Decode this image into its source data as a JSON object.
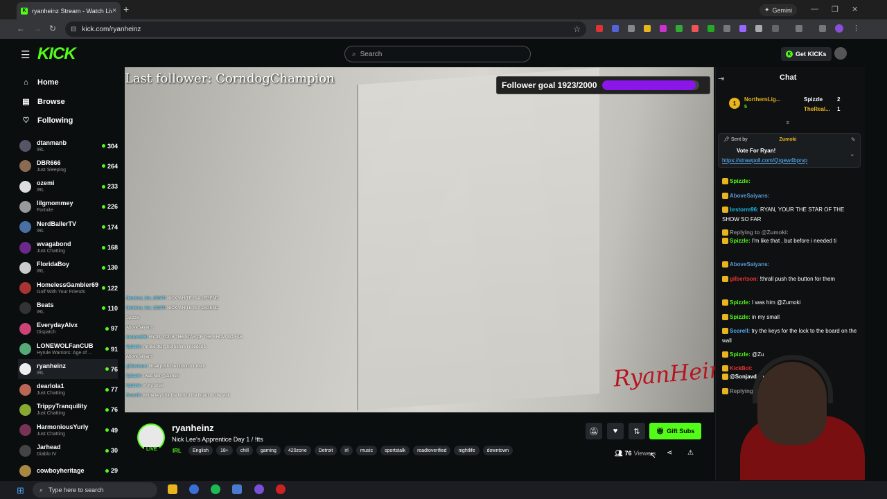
{
  "browser": {
    "tab_title": "ryanheinz Stream - Watch Live...",
    "tab_close": "×",
    "new_tab": "+",
    "gemini_label": "Gemini",
    "url": "kick.com/ryanheinz"
  },
  "header": {
    "logo": "KICK",
    "search_placeholder": "Search",
    "get_kicks": "Get KICKs"
  },
  "sidebar": {
    "nav": [
      {
        "label": "Home",
        "icon": "home-icon"
      },
      {
        "label": "Browse",
        "icon": "browse-icon"
      },
      {
        "label": "Following",
        "icon": "heart-icon"
      }
    ],
    "channels": [
      {
        "name": "dtanmanb",
        "category": "IRL",
        "viewers": "304",
        "color": "#556"
      },
      {
        "name": "DBR666",
        "category": "Just Sleeping",
        "viewers": "264",
        "color": "#8a6a52"
      },
      {
        "name": "ozemi",
        "category": "IRL",
        "viewers": "233",
        "color": "#ddd"
      },
      {
        "name": "lilgmommey",
        "category": "Fortnite",
        "viewers": "226",
        "color": "#999"
      },
      {
        "name": "NerdBallerTV",
        "category": "IRL",
        "viewers": "174",
        "color": "#4a6fa5"
      },
      {
        "name": "wvagabond",
        "category": "Just Chatting",
        "viewers": "168",
        "color": "#6b2a8a"
      },
      {
        "name": "FloridaBoy",
        "category": "IRL",
        "viewers": "130",
        "color": "#ccc"
      },
      {
        "name": "HomelessGambler69",
        "category": "Golf With Your Friends",
        "viewers": "122",
        "color": "#a33"
      },
      {
        "name": "Beats",
        "category": "IRL",
        "viewers": "110",
        "color": "#333"
      },
      {
        "name": "EverydayAlvx",
        "category": "Dispatch",
        "viewers": "97",
        "color": "#c47"
      },
      {
        "name": "LONEWOLFanCUB",
        "category": "Hyrule Warriors: Age of ...",
        "viewers": "91",
        "color": "#5a7"
      },
      {
        "name": "ryanheinz",
        "category": "IRL",
        "viewers": "76",
        "color": "#eee"
      },
      {
        "name": "dearlola1",
        "category": "Just Chatting",
        "viewers": "77",
        "color": "#b65"
      },
      {
        "name": "TrippyTranquility",
        "category": "Just Chatting",
        "viewers": "76",
        "color": "#8a3"
      },
      {
        "name": "HarmoniousYurly",
        "category": "Just Chatting",
        "viewers": "49",
        "color": "#735"
      },
      {
        "name": "Jarhead",
        "category": "Diablo IV",
        "viewers": "30",
        "color": "#444"
      },
      {
        "name": "cowboyheritage",
        "category": "",
        "viewers": "29",
        "color": "#a84"
      }
    ]
  },
  "video": {
    "last_follower": "Last follower: CorndogChampion",
    "goal_label": "Follower goal 1923/2000",
    "goal_progress": 0.9615,
    "watermark": "RyanHeinz",
    "overlay_chat": [
      {
        "user": "Demiroz_the_GOAT:",
        "text": "NICK WHITE IS A LEGEND"
      },
      {
        "user": "Demiroz_the_GOAT:",
        "text": "NICK WHITE IS A LEGEND"
      },
      {
        "user": "",
        "text": "Spizzle"
      },
      {
        "user": "",
        "text": "AboveSaiyans:"
      },
      {
        "user": "brstorm96:",
        "text": "RYAN, YOUR THE STAR OF THE SHOW SO FAR"
      },
      {
        "user": "Spizzle:",
        "text": "I'm like that , but before i needed ti"
      },
      {
        "user": "",
        "text": "AboveSaiyans:"
      },
      {
        "user": "gilbertson:",
        "text": "!thrall push the button for them"
      },
      {
        "user": "Spizzle:",
        "text": "I was him @Zumoki"
      },
      {
        "user": "Spizzle:",
        "text": "in my small"
      },
      {
        "user": "Scorell:",
        "text": "try the keys for the lock to the board on the wall"
      }
    ]
  },
  "stream_info": {
    "live": "LIVE",
    "channel": "ryanheinz",
    "title": "Nick Lee's Apprentice Day 1 / !tts",
    "category": "IRL",
    "tags": [
      "English",
      "18+",
      "chill",
      "gaming",
      "420zone",
      "Detroit",
      "irl",
      "music",
      "sportstalk",
      "roadtoverified",
      "nightlife",
      "downtown"
    ],
    "gift_subs": "Gift Subs",
    "viewers_count": "76",
    "viewers_label": "Viewers"
  },
  "chat": {
    "title": "Chat",
    "leaderboard": [
      {
        "rank": "1",
        "name": "NorthernLig...",
        "sub": "5"
      },
      {
        "name": "Spizzle",
        "count": "2"
      },
      {
        "name": "TheReal...",
        "count": "1"
      }
    ],
    "pinned": {
      "sent_by": "Sent by",
      "sender": "Zumoki",
      "message": "Vote For Ryan!",
      "link": "https://strawpoll.com/Qrgew4bprvp"
    },
    "messages": [
      {
        "user": "Spizzle:",
        "text": "",
        "color": "#53fc18"
      },
      {
        "user": "AboveSaiyans:",
        "text": "",
        "color": "#5b9bd5"
      },
      {
        "user": "brstorm96:",
        "text": "RYAN, YOUR THE STAR OF THE SHOW SO FAR",
        "color": "#1db7e0"
      },
      {
        "user": "Replying to @Zumoki:",
        "text": "",
        "color": "#888"
      },
      {
        "user": "Spizzle:",
        "text": "I'm like that , but before i needed ti",
        "color": "#53fc18"
      },
      {
        "user": "AboveSaiyans:",
        "text": "",
        "color": "#5b9bd5"
      },
      {
        "user": "gilbertson:",
        "text": "!thrall push the button for them",
        "color": "#e33"
      },
      {
        "user": "Spizzle:",
        "text": "I was him @Zumoki",
        "color": "#53fc18"
      },
      {
        "user": "Spizzle:",
        "text": "in my small",
        "color": "#53fc18"
      },
      {
        "user": "Scorell:",
        "text": "try the keys for the lock to the board on the wall",
        "color": "#5ab4ff"
      },
      {
        "user": "Spizzle:",
        "text": "@Zumoki",
        "color": "#53fc18"
      },
      {
        "user": "KickBot:",
        "text": "",
        "color": "#e33"
      },
      {
        "user": "@Sonjavd_Tc",
        "text": "",
        "color": "#fff"
      },
      {
        "user": "Replying to",
        "text": "",
        "color": "#888"
      }
    ]
  },
  "taskbar": {
    "search_placeholder": "Type here to search"
  }
}
